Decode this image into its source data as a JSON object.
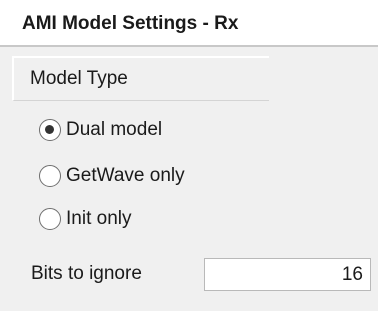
{
  "panel": {
    "title": "AMI Model Settings - Rx"
  },
  "model_type": {
    "label": "Model Type",
    "options": [
      {
        "label": "Dual model",
        "checked": true
      },
      {
        "label": "GetWave only",
        "checked": false
      },
      {
        "label": "Init only",
        "checked": false
      }
    ]
  },
  "bits_to_ignore": {
    "label": "Bits to ignore",
    "value": "16"
  }
}
